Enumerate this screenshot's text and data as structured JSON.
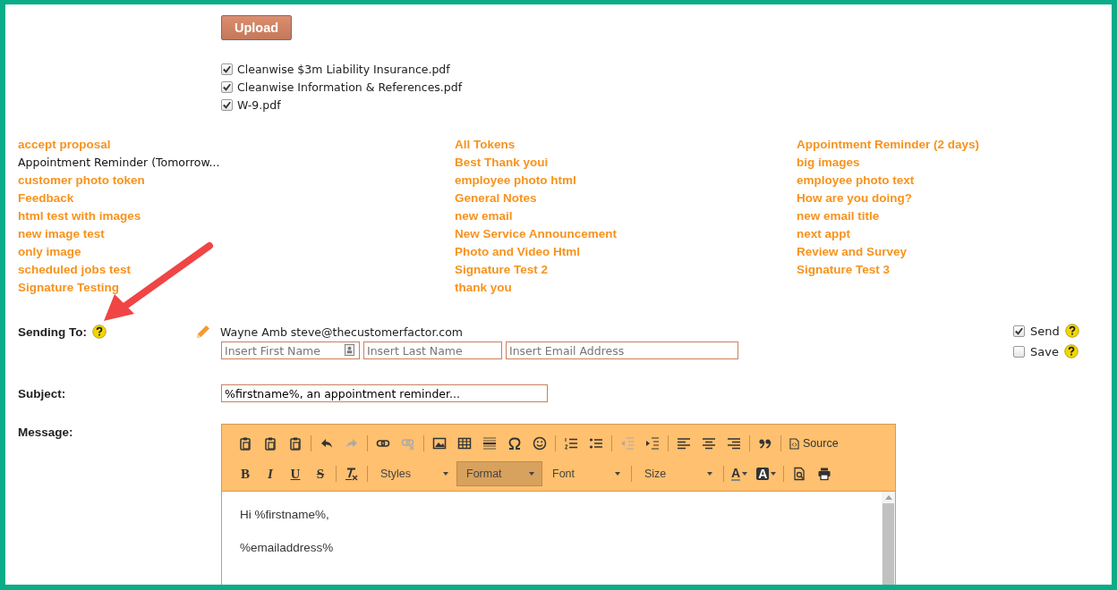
{
  "upload": {
    "button": "Upload"
  },
  "attachments": [
    {
      "name": "Cleanwise $3m Liability Insurance.pdf",
      "checked": true
    },
    {
      "name": "Cleanwise Information & References.pdf",
      "checked": true
    },
    {
      "name": "W-9.pdf",
      "checked": true
    }
  ],
  "templates": [
    [
      {
        "label": "accept proposal",
        "selected": false
      },
      {
        "label": "Appointment Reminder (Tomorrow...",
        "selected": true
      },
      {
        "label": "customer photo token",
        "selected": false
      },
      {
        "label": "Feedback",
        "selected": false
      },
      {
        "label": "html test with images",
        "selected": false
      },
      {
        "label": "new image test",
        "selected": false
      },
      {
        "label": "only image",
        "selected": false
      },
      {
        "label": "scheduled jobs test",
        "selected": false
      },
      {
        "label": "Signature Testing",
        "selected": false
      }
    ],
    [
      {
        "label": "All Tokens",
        "selected": false
      },
      {
        "label": "Best Thank youi",
        "selected": false
      },
      {
        "label": "employee photo html",
        "selected": false
      },
      {
        "label": "General Notes",
        "selected": false
      },
      {
        "label": "new email",
        "selected": false
      },
      {
        "label": "New Service Announcement",
        "selected": false
      },
      {
        "label": "Photo and Video Html",
        "selected": false
      },
      {
        "label": "Signature Test 2",
        "selected": false
      },
      {
        "label": "thank you",
        "selected": false
      }
    ],
    [
      {
        "label": "Appointment Reminder (2 days)",
        "selected": false
      },
      {
        "label": "big images",
        "selected": false
      },
      {
        "label": "employee photo text",
        "selected": false
      },
      {
        "label": "How are you doing?",
        "selected": false
      },
      {
        "label": "new email title",
        "selected": false
      },
      {
        "label": "next appt",
        "selected": false
      },
      {
        "label": "Review and Survey",
        "selected": false
      },
      {
        "label": "Signature Test 3",
        "selected": false
      }
    ]
  ],
  "sending_to": {
    "label": "Sending To:",
    "recipient": "Wayne Amb steve@thecustomerfactor.com",
    "fields": [
      {
        "placeholder": "Insert First Name",
        "kind": "contact"
      },
      {
        "placeholder": "Insert Last Name",
        "kind": "plain"
      },
      {
        "placeholder": "Insert Email Address",
        "kind": "plain"
      }
    ],
    "options": [
      {
        "label": "Send",
        "checked": true
      },
      {
        "label": "Save",
        "checked": false
      }
    ]
  },
  "subject": {
    "label": "Subject:",
    "value": "%firstname%, an appointment reminder..."
  },
  "message": {
    "label": "Message:",
    "toolbar": [
      [
        {
          "kind": "paste",
          "disabled": false
        },
        {
          "kind": "paste-text",
          "disabled": false
        },
        {
          "kind": "paste-word",
          "disabled": false
        },
        {
          "kind": "separator"
        },
        {
          "kind": "undo",
          "disabled": false
        },
        {
          "kind": "redo",
          "disabled": true
        },
        {
          "kind": "separator"
        },
        {
          "kind": "link",
          "disabled": false
        },
        {
          "kind": "unlink",
          "disabled": true
        },
        {
          "kind": "separator"
        },
        {
          "kind": "image",
          "disabled": false
        },
        {
          "kind": "table",
          "disabled": false
        },
        {
          "kind": "hline",
          "disabled": false
        },
        {
          "kind": "omega",
          "disabled": false
        },
        {
          "kind": "smiley",
          "disabled": false
        },
        {
          "kind": "separator"
        },
        {
          "kind": "numlist",
          "disabled": false
        },
        {
          "kind": "bulllist",
          "disabled": false
        },
        {
          "kind": "separator"
        },
        {
          "kind": "outdent",
          "disabled": true
        },
        {
          "kind": "indent",
          "disabled": false
        },
        {
          "kind": "separator"
        },
        {
          "kind": "align-left",
          "disabled": false
        },
        {
          "kind": "align-center",
          "disabled": false
        },
        {
          "kind": "align-right",
          "disabled": false
        },
        {
          "kind": "separator"
        },
        {
          "kind": "quote",
          "disabled": false
        },
        {
          "kind": "separator"
        },
        {
          "kind": "source",
          "label": "Source"
        }
      ],
      [
        {
          "kind": "bold",
          "label": "B"
        },
        {
          "kind": "italic",
          "label": "I"
        },
        {
          "kind": "underline",
          "label": "U"
        },
        {
          "kind": "strike",
          "label": "S"
        },
        {
          "kind": "separator"
        },
        {
          "kind": "removeformat",
          "disabled": false
        },
        {
          "kind": "separator"
        },
        {
          "kind": "combo",
          "label": "Styles",
          "selected": false
        },
        {
          "kind": "combo",
          "label": "Format",
          "selected": true
        },
        {
          "kind": "combo",
          "label": "Font",
          "selected": false
        },
        {
          "kind": "separator"
        },
        {
          "kind": "combo",
          "label": "Size",
          "selected": false
        },
        {
          "kind": "separator"
        },
        {
          "kind": "textcolor",
          "label": "A"
        },
        {
          "kind": "bgcolor",
          "label": "A"
        },
        {
          "kind": "separator"
        },
        {
          "kind": "preview",
          "disabled": false
        },
        {
          "kind": "print",
          "disabled": false
        }
      ]
    ],
    "body": [
      "Hi %firstname%,",
      "%emailaddress%"
    ]
  }
}
